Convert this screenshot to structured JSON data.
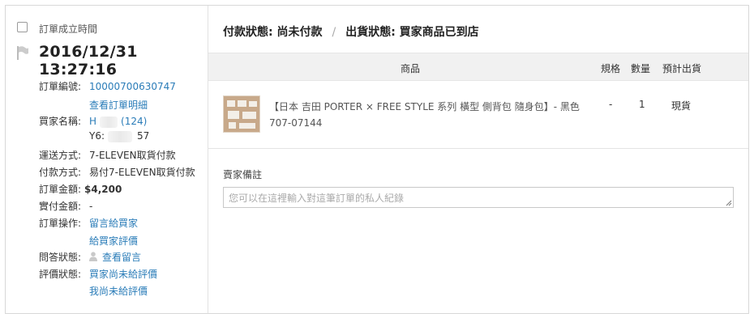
{
  "order": {
    "time_label": "訂單成立時間",
    "time": "2016/12/31 13:27:16",
    "number_label": "訂單編號:",
    "number": "10000700630747",
    "detail_link": "查看訂單明細",
    "buyer_label": "買家名稱:",
    "buyer_name": "H",
    "buyer_rating": "(124)",
    "buyer_id_prefix": "Y6:",
    "buyer_id_suffix": "57",
    "shipping_label": "運送方式:",
    "shipping": "7-ELEVEN取貨付款",
    "payment_label": "付款方式:",
    "payment": "易付7-ELEVEN取貨付款",
    "amount_label": "訂單金額:",
    "amount": "$4,200",
    "paid_label": "實付金額:",
    "paid": "-",
    "actions_label": "訂單操作:",
    "action_message": "留言給買家",
    "action_rate": "給買家評價",
    "qa_label": "問答狀態:",
    "qa_link": "查看留言",
    "review_label": "評價狀態:",
    "review_buyer": "買家尚未給評價",
    "review_me": "我尚未給評價"
  },
  "status": {
    "payment": "付款狀態: 尚未付款",
    "separator": "/",
    "shipping": "出貨狀態: 買家商品已到店"
  },
  "table": {
    "headers": {
      "product": "商品",
      "spec": "規格",
      "qty": "數量",
      "eta": "預計出貨"
    },
    "items": [
      {
        "name": "【日本 吉田 PORTER × FREE STYLE 系列 橫型 側背包 隨身包】- 黑色 707-07144",
        "spec": "-",
        "qty": "1",
        "eta": "現貨"
      }
    ]
  },
  "note": {
    "label": "賣家備註",
    "placeholder": "您可以在這裡輸入對這筆訂單的私人紀錄"
  }
}
